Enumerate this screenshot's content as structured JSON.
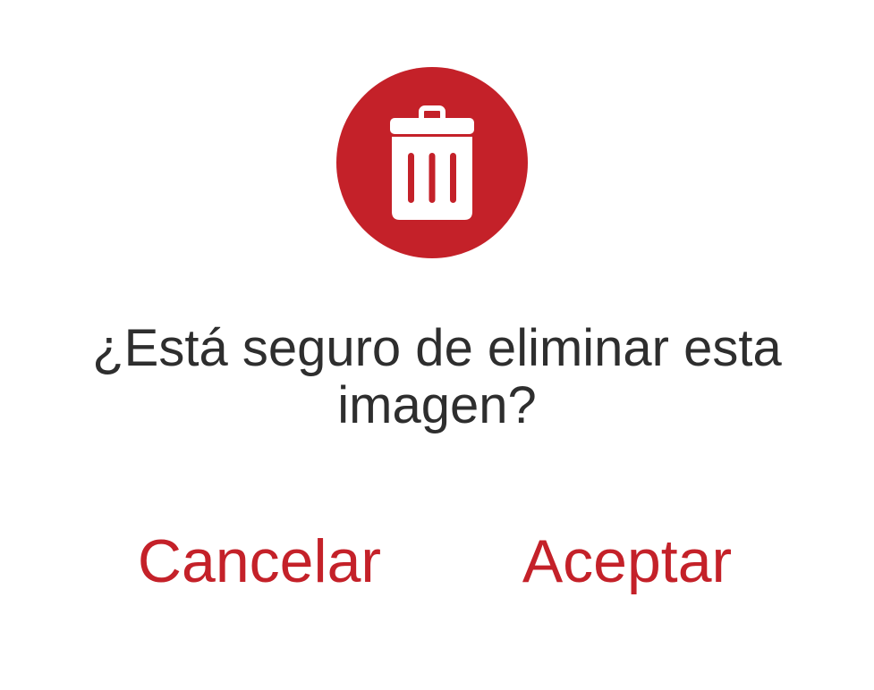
{
  "dialog": {
    "icon": "trash-can-icon",
    "message": "¿Está seguro de eliminar esta imagen?",
    "cancel_label": "Cancelar",
    "accept_label": "Aceptar"
  },
  "colors": {
    "accent": "#c42129",
    "text": "#2e2e2e",
    "background": "#ffffff"
  }
}
